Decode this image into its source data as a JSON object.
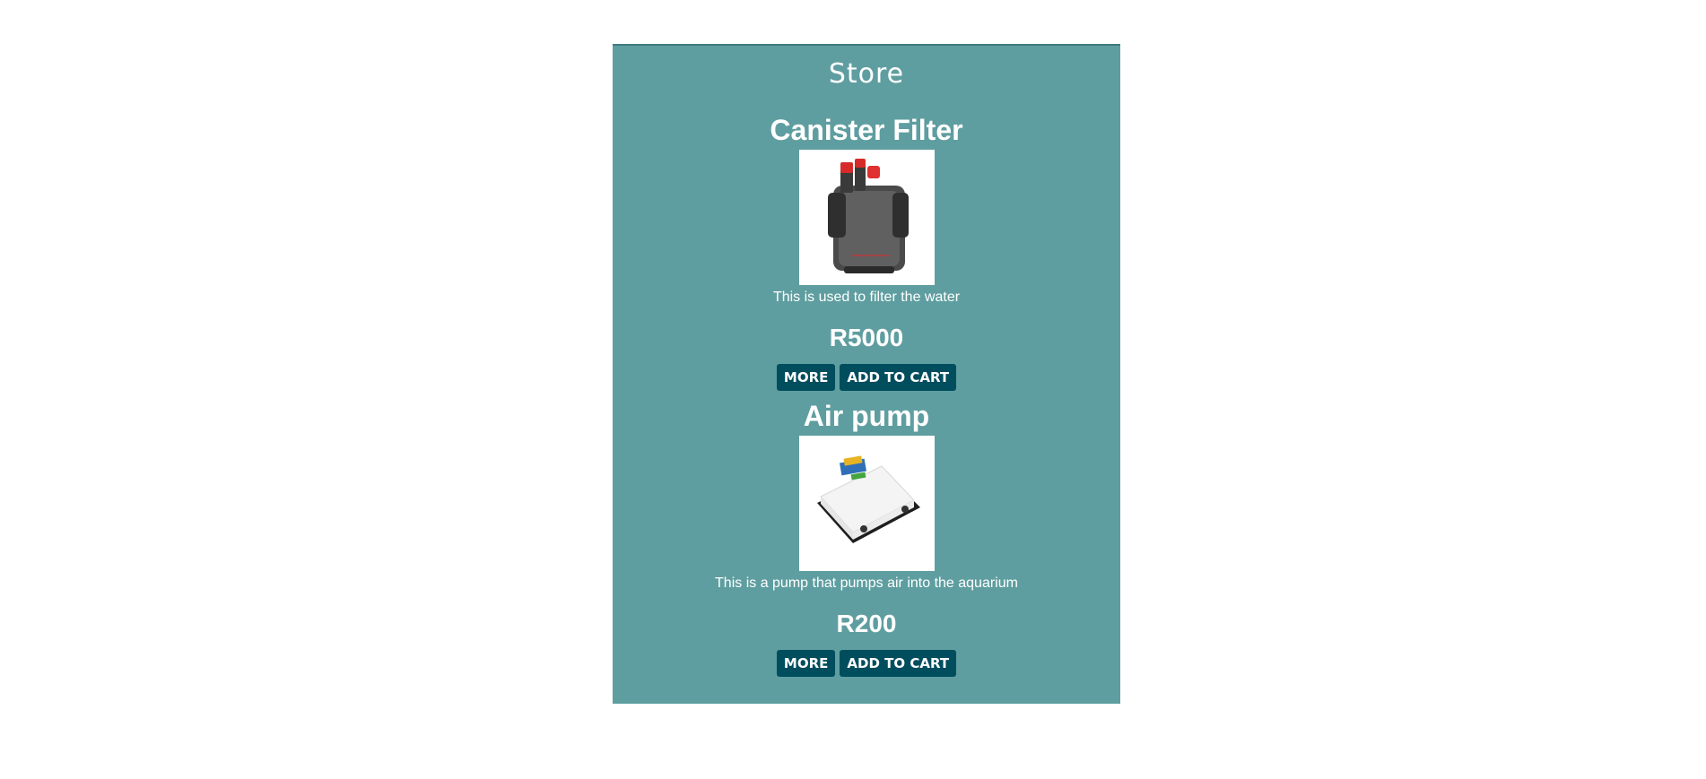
{
  "store": {
    "title": "Store",
    "products": [
      {
        "name": "Canister Filter",
        "image_icon": "canister-filter-image",
        "description": "This is used to filter the water",
        "price": "R5000",
        "more_label": "MORE",
        "add_label": "ADD TO CART"
      },
      {
        "name": "Air pump",
        "image_icon": "air-pump-image",
        "description": "This is a pump that pumps air into the aquarium",
        "price": "R200",
        "more_label": "MORE",
        "add_label": "ADD TO CART"
      }
    ]
  },
  "colors": {
    "panel": "#5f9ea0",
    "button": "#004d5e",
    "text": "#ffffff"
  }
}
